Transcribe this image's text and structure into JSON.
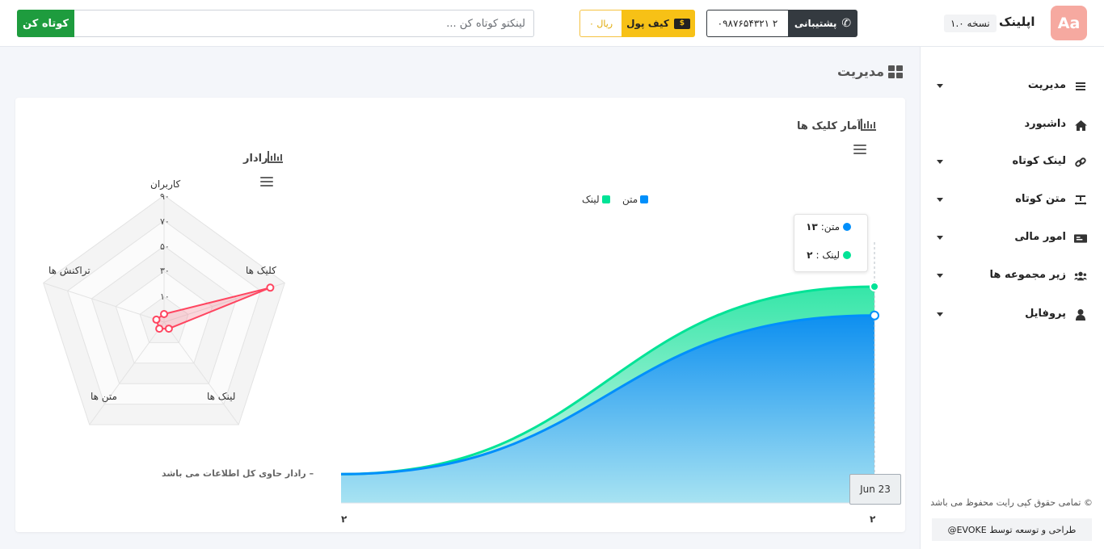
{
  "topbar": {
    "shorten_button": "کوتاه کن",
    "url_placeholder": "لینکتو کوتاه کن ...",
    "wallet_amount": "۰ ریال",
    "wallet_label": "کیف پول",
    "wallet_icon_text": "$",
    "phone": "۰۹۸۷۶۵۴۳۲۱ ۲",
    "support_label": "پشتیبانی",
    "logo_text": "Aa",
    "app_name": "اپلینک",
    "version": "۱.۰ نسخه"
  },
  "sidebar": {
    "items": [
      {
        "label": "مدیریت",
        "icon": "bars-icon",
        "has_caret": true
      },
      {
        "label": "داشبورد",
        "icon": "home-icon",
        "has_caret": false
      },
      {
        "label": "لینک کوتاه",
        "icon": "link-icon",
        "has_caret": true
      },
      {
        "label": "متن کوتاه",
        "icon": "text-icon",
        "has_caret": true
      },
      {
        "label": "امور مالی",
        "icon": "money-icon",
        "has_caret": true
      },
      {
        "label": "زیر مجموعه ها",
        "icon": "users-icon",
        "has_caret": true
      },
      {
        "label": "پروفایل",
        "icon": "user-icon",
        "has_caret": true
      }
    ],
    "copyright": "© تمامی حقوق کپی رایت محفوظ می باشد",
    "credit": "طراحی و توسعه توسط EVOKE@"
  },
  "main": {
    "page_title": "مدیریت"
  },
  "area_chart": {
    "title": "آمار کلیک ها",
    "legend": [
      {
        "name": "متن",
        "color": "#008ffb"
      },
      {
        "name": "لینک",
        "color": "#00e396"
      }
    ],
    "tooltip": {
      "row1_label": "متن:",
      "row1_value": "۱۳",
      "row2_label": "لینک :",
      "row2_value": "۲"
    },
    "x_tooltip": "Jun 23",
    "x_tick_left": "۲",
    "x_tick_right": "۲"
  },
  "radar_chart": {
    "title": "رادار",
    "note": "– رادار حاوی کل اطلاعات می باشد",
    "axes": [
      "کاربران",
      "کلیک ها",
      "لینک ها",
      "متن ها",
      "تراکنش ها"
    ],
    "ticks": [
      "۹۰",
      "۷۰",
      "۵۰",
      "۳۰",
      "۱۰"
    ]
  },
  "chart_data": [
    {
      "type": "area",
      "title": "آمار کلیک ها",
      "x": [
        "",
        "Jun 23"
      ],
      "series": [
        {
          "name": "متن",
          "values": [
            2,
            13
          ]
        },
        {
          "name": "لینک",
          "values": [
            0,
            2
          ]
        }
      ],
      "stacked": true,
      "legend": "top",
      "grid": false
    },
    {
      "type": "radar",
      "title": "رادار",
      "categories": [
        "کاربران",
        "کلیک ها",
        "لینک ها",
        "متن ها",
        "تراکنش ها"
      ],
      "series": [
        {
          "values": [
            0,
            88,
            4,
            0,
            3
          ]
        }
      ],
      "ylim": [
        0,
        100
      ],
      "ticks": [
        10,
        30,
        50,
        70,
        90
      ]
    }
  ],
  "colors": {
    "green": "#1e9c3e",
    "yellow": "#f7c116",
    "dark": "#343a40",
    "series_text": "#008ffb",
    "series_link": "#00e396",
    "radar": "#ff4560"
  }
}
